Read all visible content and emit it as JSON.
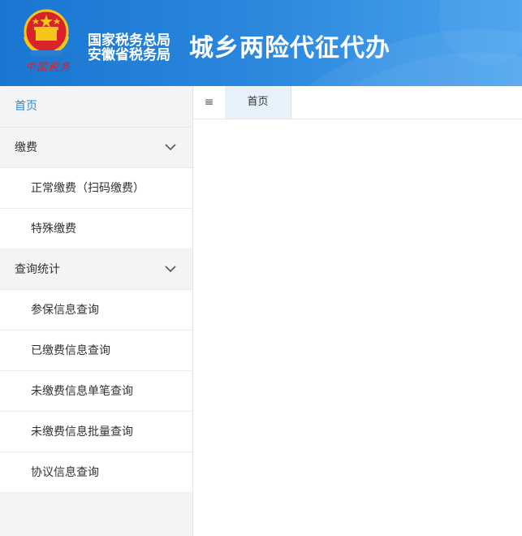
{
  "header": {
    "org_line1": "国家税务总局",
    "org_line2": "安徽省税务局",
    "system_title": "城乡两险代征代办",
    "brand_script": "中国税务",
    "colors": {
      "banner_start": "#1976d2",
      "banner_end": "#4aa3ee",
      "emblem_red": "#d8232a",
      "emblem_gold": "#f5c518"
    }
  },
  "sidebar": {
    "home": {
      "label": "首页"
    },
    "groups": [
      {
        "label": "缴费",
        "expanded": true,
        "items": [
          {
            "label": "正常缴费（扫码缴费）"
          },
          {
            "label": "特殊缴费"
          }
        ]
      },
      {
        "label": "查询统计",
        "expanded": true,
        "items": [
          {
            "label": "参保信息查询"
          },
          {
            "label": "已缴费信息查询"
          },
          {
            "label": "未缴费信息单笔查询"
          },
          {
            "label": "未缴费信息批量查询"
          },
          {
            "label": "协议信息查询"
          }
        ]
      }
    ]
  },
  "tabbar": {
    "menu_toggle": "≡",
    "tabs": [
      {
        "label": "首页",
        "active": true
      }
    ]
  },
  "icons": {
    "emblem": "national-emblem-icon",
    "chevron": "chevron-down-icon",
    "menu": "menu-icon"
  }
}
